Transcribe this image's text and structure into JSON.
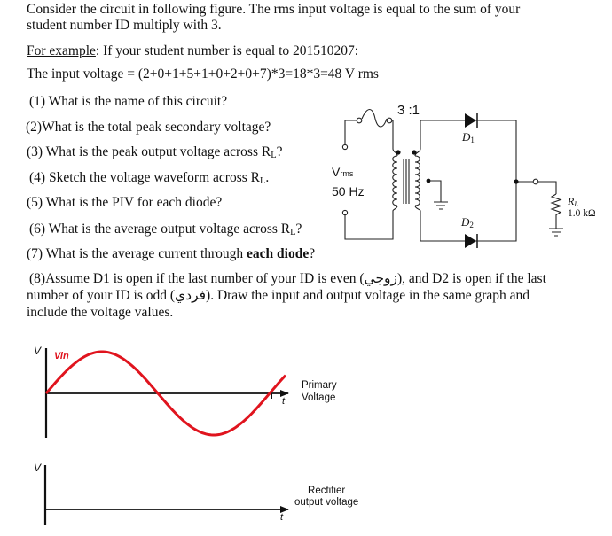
{
  "intro": {
    "line1": "Consider the circuit in following figure. The rms input voltage is equal to the sum of your",
    "line2": "student number ID multiply with 3.",
    "example_label": "For example",
    "example_text": ": If your student number is equal to 201510207:",
    "input_voltage": "The input voltage = (2+0+1+5+1+0+2+0+7)*3=18*3=48 V rms"
  },
  "questions": [
    {
      "prefix": "(1) What is the name of this circuit?",
      "bold": "",
      "suffix": ""
    },
    {
      "prefix": "(2)What is the total peak secondary voltage?",
      "bold": "",
      "suffix": ""
    },
    {
      "prefix": "(3) What is the peak output voltage across R",
      "sub": "L",
      "suffix": "?"
    },
    {
      "prefix": "(4) Sketch the voltage waveform across R",
      "sub": "L",
      "suffix": "."
    },
    {
      "prefix": "(5) What is the PIV for each diode?",
      "bold": "",
      "suffix": ""
    },
    {
      "prefix": "(6) What is the average output voltage across R",
      "sub": "L",
      "suffix": "?"
    },
    {
      "prefix": "(7) What is the average current through ",
      "bold": "each diode",
      "suffix": "?"
    }
  ],
  "question8": {
    "line1": "(8)Assume D1 is open if the last number of your ID is even (زوجي), and D2 is open if the last",
    "line2": "number of your ID is odd (فردي). Draw the input and output voltage in the same graph and",
    "line3": "include the voltage values."
  },
  "circuit": {
    "turns_ratio": "3 :1",
    "source_label": "V",
    "source_label_sub": "rms",
    "frequency": "50 Hz",
    "diode1": "D",
    "diode1_sub": "1",
    "diode2": "D",
    "diode2_sub": "2",
    "load_label": "R",
    "load_label_sub": "L",
    "load_value": "1.0 kΩ"
  },
  "graph_input": {
    "y_label": "V",
    "x_label": "t",
    "series_label": "Vin",
    "caption_line1": "Primary",
    "caption_line2": "Voltage",
    "wave_color": "#e0141e"
  },
  "graph_output": {
    "y_label": "V",
    "x_label": "t",
    "caption_line1": "Rectifier",
    "caption_line2": "output voltage"
  }
}
